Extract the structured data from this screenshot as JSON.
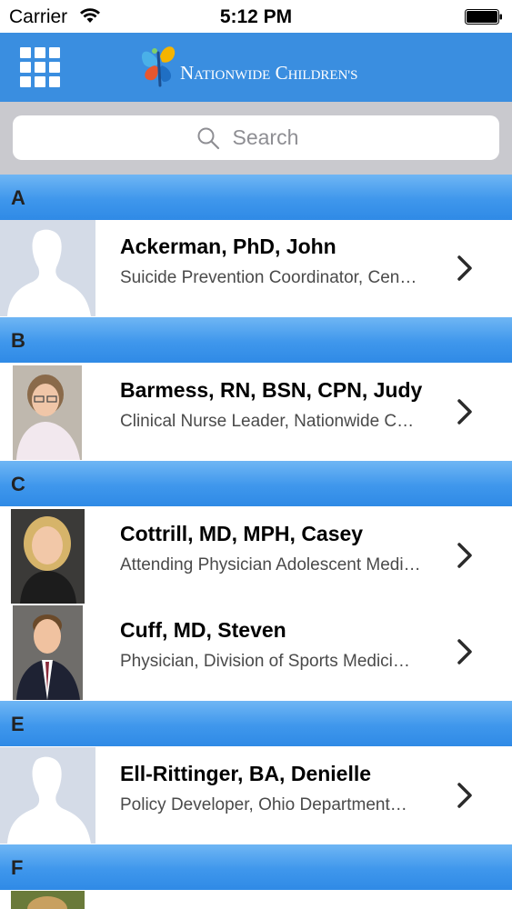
{
  "status_bar": {
    "carrier": "Carrier",
    "time": "5:12 PM"
  },
  "header": {
    "logo_text": "NATIONWIDE CHILDREN'S",
    "logo_text_display": "Nationwide Children's",
    "menu_icon": "grid-icon",
    "bar_color": "#3a8ee0"
  },
  "search": {
    "placeholder": "Search",
    "icon": "search-icon"
  },
  "sections": [
    {
      "letter": "A",
      "rows": [
        {
          "name": "Ackerman, PhD, John",
          "subtitle": "Suicide Prevention Coordinator,  Cen…",
          "avatar": "placeholder-silhouette"
        }
      ]
    },
    {
      "letter": "B",
      "rows": [
        {
          "name": "Barmess, RN, BSN, CPN, Judy",
          "subtitle": "Clinical Nurse Leader,  Nationwide C…",
          "avatar": "photo"
        }
      ]
    },
    {
      "letter": "C",
      "rows": [
        {
          "name": "Cottrill, MD, MPH, Casey",
          "subtitle": "Attending Physician Adolescent Medi…",
          "avatar": "photo"
        },
        {
          "name": "Cuff, MD, Steven",
          "subtitle": "Physician,  Division of Sports Medici…",
          "avatar": "photo"
        }
      ]
    },
    {
      "letter": "E",
      "rows": [
        {
          "name": "Ell-Rittinger, BA, Denielle",
          "subtitle": "Policy Developer,  Ohio Department…",
          "avatar": "placeholder-silhouette"
        }
      ]
    },
    {
      "letter": "F",
      "rows": []
    }
  ],
  "colors": {
    "section_header": "#3f97ec",
    "search_background": "#c9c9ce"
  }
}
